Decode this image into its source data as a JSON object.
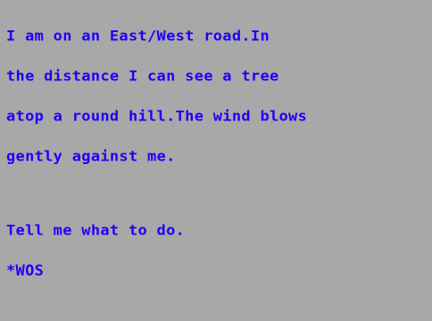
{
  "game": {
    "description_lines": [
      "I am on an East/West road.In",
      "the distance I can see a tree",
      "atop a round hill.The wind blows",
      "gently against me."
    ],
    "prompt": "Tell me what to do.",
    "input": "*WOS"
  },
  "colors": {
    "background": "#a8a8a8",
    "text": "#1f00f8"
  }
}
